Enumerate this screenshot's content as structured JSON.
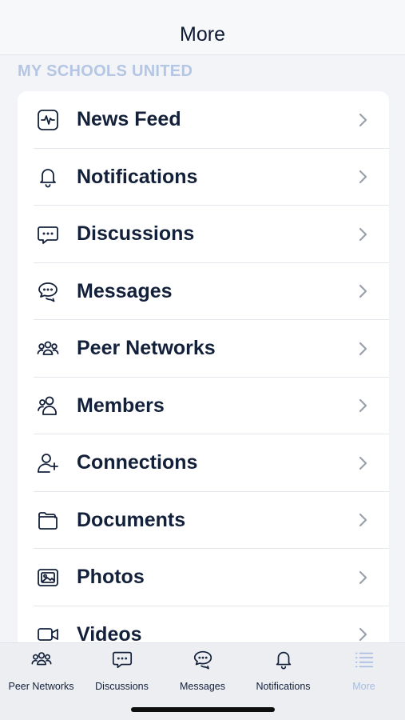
{
  "header": {
    "title": "More"
  },
  "section": {
    "label": "MY SCHOOLS UNITED"
  },
  "menu": [
    {
      "label": "News Feed",
      "icon": "news-feed-icon"
    },
    {
      "label": "Notifications",
      "icon": "bell-icon"
    },
    {
      "label": "Discussions",
      "icon": "chat-bubble-icon"
    },
    {
      "label": "Messages",
      "icon": "messages-icon"
    },
    {
      "label": "Peer Networks",
      "icon": "group-icon"
    },
    {
      "label": "Members",
      "icon": "members-icon"
    },
    {
      "label": "Connections",
      "icon": "add-user-icon"
    },
    {
      "label": "Documents",
      "icon": "folder-icon"
    },
    {
      "label": "Photos",
      "icon": "photo-icon"
    },
    {
      "label": "Videos",
      "icon": "video-icon"
    }
  ],
  "tabs": [
    {
      "label": "Peer Networks",
      "icon": "group-icon"
    },
    {
      "label": "Discussions",
      "icon": "chat-bubble-icon"
    },
    {
      "label": "Messages",
      "icon": "messages-icon"
    },
    {
      "label": "Notifications",
      "icon": "bell-icon"
    },
    {
      "label": "More",
      "icon": "list-icon",
      "active": true
    }
  ],
  "colors": {
    "accent_inactive": "#a9bce0",
    "text": "#13203a",
    "section_label": "#b4c6e4"
  }
}
